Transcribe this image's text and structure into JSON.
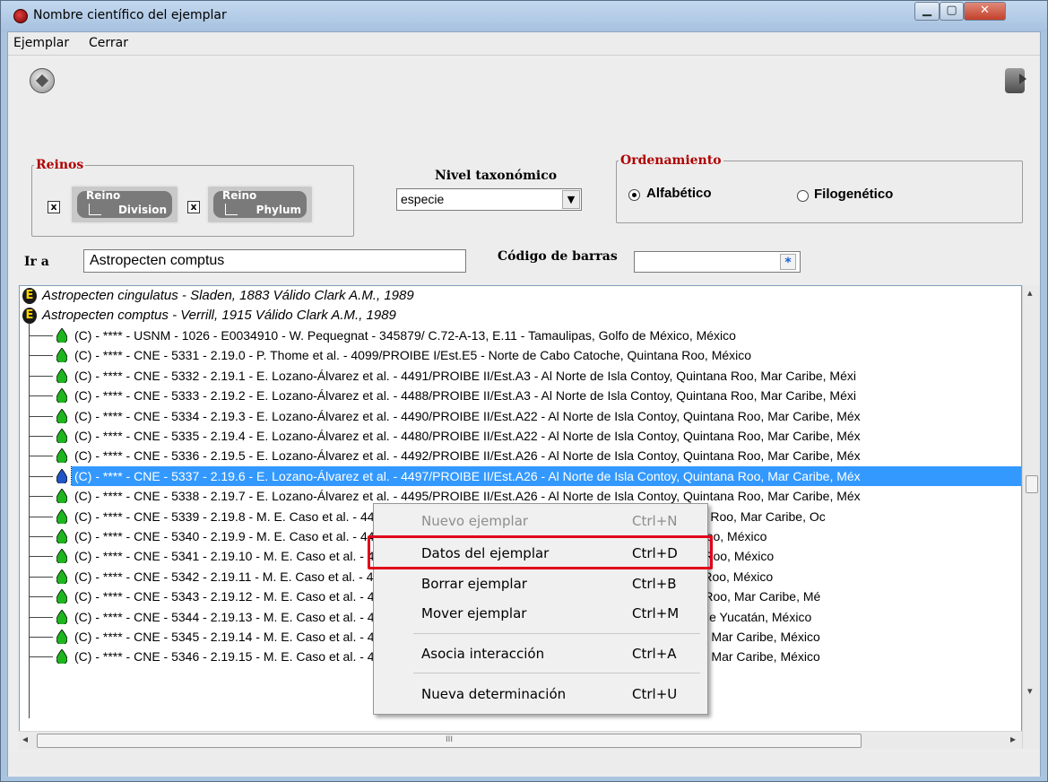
{
  "window": {
    "title": "Nombre científico del ejemplar",
    "min": "▁",
    "max": "▢",
    "close": "✕"
  },
  "menu": {
    "items": [
      "Ejemplar",
      "Cerrar"
    ]
  },
  "reinos": {
    "legend": "Reinos",
    "check1": "x",
    "btn1_top": "Reino",
    "btn1_bottom": "Division",
    "check2": "x",
    "btn2_top": "Reino",
    "btn2_bottom": "Phylum"
  },
  "nivel": {
    "label": "Nivel taxonómico",
    "value": "especie"
  },
  "orden": {
    "legend": "Ordenamiento",
    "opt1": "Alfabético",
    "opt2": "Filogenético",
    "selected": "Alfabético"
  },
  "ir_a": {
    "label": "Ir a",
    "value": "Astropecten comptus"
  },
  "codigo": {
    "label": "Código de barras",
    "btn": "*"
  },
  "tree": {
    "taxa": [
      "Astropecten cingulatus - Sladen, 1883  Válido  Clark A.M., 1989",
      "Astropecten comptus - Verrill, 1915  Válido  Clark A.M., 1989"
    ],
    "rows": [
      "(C) - **** - USNM - 1026 - E0034910 - W. Pequegnat - 345879/ C.72-A-13, E.11 - Tamaulipas, Golfo de México, México",
      "(C) - **** - CNE - 5331 - 2.19.0 - P. Thome et al. - 4099/PROIBE I/Est.E5 - Norte de Cabo Catoche, Quintana Roo, México",
      "(C) - **** - CNE - 5332 - 2.19.1 - E. Lozano-Álvarez et al. - 4491/PROIBE II/Est.A3 - Al Norte de Isla Contoy, Quintana Roo, Mar Caribe, Méxi",
      "(C) - **** - CNE - 5333 - 2.19.2 - E. Lozano-Álvarez et al. - 4488/PROIBE II/Est.A3 - Al Norte de Isla Contoy, Quintana Roo, Mar Caribe, Méxi",
      "(C) - **** - CNE - 5334 - 2.19.3 - E. Lozano-Álvarez et al. - 4490/PROIBE II/Est.A22 - Al Norte de Isla Contoy, Quintana Roo, Mar Caribe, Méx",
      "(C) - **** - CNE - 5335 - 2.19.4 - E. Lozano-Álvarez et al. - 4480/PROIBE II/Est.A22 - Al Norte de Isla Contoy, Quintana Roo, Mar Caribe, Méx",
      "(C) - **** - CNE - 5336 - 2.19.5 - E. Lozano-Álvarez et al. - 4492/PROIBE II/Est.A26 - Al Norte de Isla Contoy, Quintana Roo, Mar Caribe, Méx",
      "(C) - **** - CNE - 5337 - 2.19.6 - E. Lozano-Álvarez et al. - 4497/PROIBE II/Est.A26 - Al Norte de Isla Contoy, Quintana Roo, Mar Caribe, Méx",
      "(C) - **** - CNE - 5338 - 2.19.7 - E. Lozano-Álvarez et al. - 4495/PROIBE II/Est.A26 - Al Norte de Isla Contoy, Quintana Roo, Mar Caribe, Méx",
      "(C) - **** - CNE - 5339 - 2.19.8 - M. E. Caso et al. - 4433/PROIBE II/Est.A28 - Al Norte de la Isla Contoy, Quintana Roo, Mar Caribe, Oc",
      "(C) - **** - CNE - 5340 - 2.19.9 - M. E. Caso et al. - 4434/PROIBE II/Est.A28 - Al Norte de Isla Contoy, Quintana Roo, México",
      "(C) - **** - CNE - 5341 - 2.19.10 - M. E. Caso et al. - 4435/PROIBE II/Est.A28 - Al Norte de Isla Contoy, Quintana Roo, México",
      "(C) - **** - CNE - 5342 - 2.19.11 - M. E. Caso et al. - 4436/PROIBE II/Est.A28 - Al Norte de Isla Contoy, Quintana Roo, México",
      "(C) - **** - CNE - 5343 - 2.19.12 - M. E. Caso et al. - 4437/PROIBE II/Est.A28 - Al Norte de Isla Contoy, Quintana Roo, Mar Caribe, Mé",
      "(C) - **** - CNE - 5344 - 2.19.13 - M. E. Caso et al. - 4438/PROIBE II/Est.A28 - Al Norte de Cabo Catoche, Norte de Yucatán, México",
      "(C) - **** - CNE - 5345 - 2.19.14 - M. E. Caso et al. - 4439/PROIBE II/Est.A28 - Al Norte de Holbox, Quintana Roo, Mar Caribe, México",
      "(C) - **** - CNE - 5346 - 2.19.15 - M. E. Caso et al. - 4440/PROIBE II/Est.A28 - Al Norte de Holbox, Quintana Roo, Mar Caribe, México"
    ],
    "selected_index": 7
  },
  "context_menu": {
    "items": [
      {
        "label": "Nuevo ejemplar",
        "shortcut": "Ctrl+N",
        "disabled": true
      },
      {
        "label": "Datos del ejemplar",
        "shortcut": "Ctrl+D",
        "disabled": false,
        "highlighted": true
      },
      {
        "label": "Borrar ejemplar",
        "shortcut": "Ctrl+B",
        "disabled": false
      },
      {
        "label": "Mover ejemplar",
        "shortcut": "Ctrl+M",
        "disabled": false
      },
      {
        "label": "Asocia interacción",
        "shortcut": "Ctrl+A",
        "disabled": false
      },
      {
        "label": "Nueva determinación",
        "shortcut": "Ctrl+U",
        "disabled": false
      }
    ]
  },
  "scroll": {
    "h_thumb_glyph": "III",
    "left_arrow": "◂",
    "right_arrow": "▸",
    "up_arrow": "▴",
    "down_arrow": "▾"
  },
  "colors": {
    "accent_red": "#b00000",
    "selection": "#3399ff",
    "highlight_border": "#e0001a",
    "drop_green": "#1fb51f",
    "drop_blue": "#2255c4"
  },
  "icons": {
    "toolbar_left": "navigate-icon",
    "toolbar_right": "exit-door-icon",
    "app": "ladybug-icon"
  }
}
